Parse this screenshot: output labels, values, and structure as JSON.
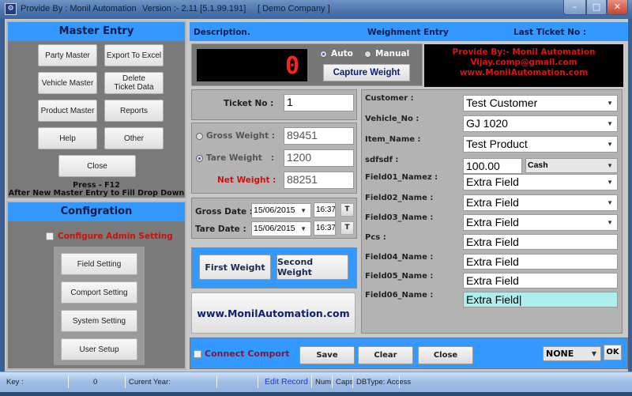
{
  "window": {
    "provide_by": "Provide By : Monil Automation",
    "version": "Version :- 2.11 [5.1.99.191]",
    "company": "[ Demo Company ]",
    "controls": {
      "minimize": "–",
      "maximize": "□",
      "close": "✕"
    }
  },
  "master_entry": {
    "title": "Master Entry",
    "buttons": [
      "Party Master",
      "Export To Excel",
      "Vehicle Master",
      "Delete Ticket Data",
      "Product Master",
      "Reports",
      "Help",
      "Other"
    ],
    "close_label": "Close",
    "note_line1": "Press - F12",
    "note_line2": "After New Master Entry to Fill Drop Down"
  },
  "configuration": {
    "title": "Configration",
    "admin_label": "Configure Admin Setting",
    "admin_checked": false,
    "buttons": [
      "Field Setting",
      "Comport Setting",
      "System Setting",
      "User Setup"
    ]
  },
  "header": {
    "description": "Description.",
    "title": "Weighment Entry",
    "last_ticket": "Last Ticket No :"
  },
  "weight_display": {
    "value": "0",
    "mode_auto": "Auto",
    "mode_manual": "Manual",
    "selected_mode": "Auto",
    "capture_label": "Capture Weight"
  },
  "promo": {
    "line1": "Provide By:- Monil Automation",
    "line2": "Vijay.comp@gmail.com",
    "line3": "www.MonilAutomation.com",
    "color": "#e01010"
  },
  "ticket": {
    "label": "Ticket No :",
    "value": "1"
  },
  "weights": {
    "gross_label": "Gross Weight :",
    "gross_value": "89451",
    "tare_label": "Tare Weight   :",
    "tare_value": "1200",
    "net_label": "Net Weight :",
    "net_value": "88251"
  },
  "dates": {
    "gross_label": "Gross Date :",
    "gross_date": "15/06/2015",
    "gross_time": "16:37",
    "tare_label": "Tare Date :",
    "tare_date": "15/06/2015",
    "tare_time": "16:37",
    "t_label": "T"
  },
  "weight_buttons": {
    "first": "First Weight",
    "second": "Second Weight"
  },
  "site_button": "www.MonilAutomation.com",
  "fields": [
    {
      "label": "Customer :",
      "value": "Test Customer",
      "type": "dropdown"
    },
    {
      "label": "Vehicle_No :",
      "value": "GJ 1020",
      "type": "dropdown"
    },
    {
      "label": "Item_Name :",
      "value": "Test Product",
      "type": "dropdown"
    },
    {
      "label": "sdfsdf  :",
      "value": "100.00",
      "type": "amount",
      "payment": "Cash"
    },
    {
      "label": "Field01_Namez  :",
      "value": "Extra Field",
      "type": "dropdown"
    },
    {
      "label": "Field02_Name :",
      "value": "Extra Field",
      "type": "dropdown"
    },
    {
      "label": "Field03_Name :",
      "value": "Extra Field",
      "type": "dropdown"
    },
    {
      "label": "Pcs :",
      "value": "Extra Field",
      "type": "text"
    },
    {
      "label": "Field04_Name :",
      "value": "Extra Field",
      "type": "text"
    },
    {
      "label": "Field05_Name :",
      "value": "Extra Field",
      "type": "text"
    },
    {
      "label": "Field06_Name :",
      "value": "Extra Field",
      "type": "text-active"
    }
  ],
  "bottom": {
    "connect_label": "Connect Comport",
    "connect_checked": false,
    "save": "Save",
    "clear": "Clear",
    "close": "Close",
    "port_value": "NONE",
    "ok": "OK"
  },
  "status": {
    "key_label": "Key :",
    "key_value": "0",
    "year_label": "Curent Year:",
    "edit_record": "Edit Record",
    "num": "Num",
    "caps": "Caps",
    "dbtype": "DBType: Access"
  }
}
